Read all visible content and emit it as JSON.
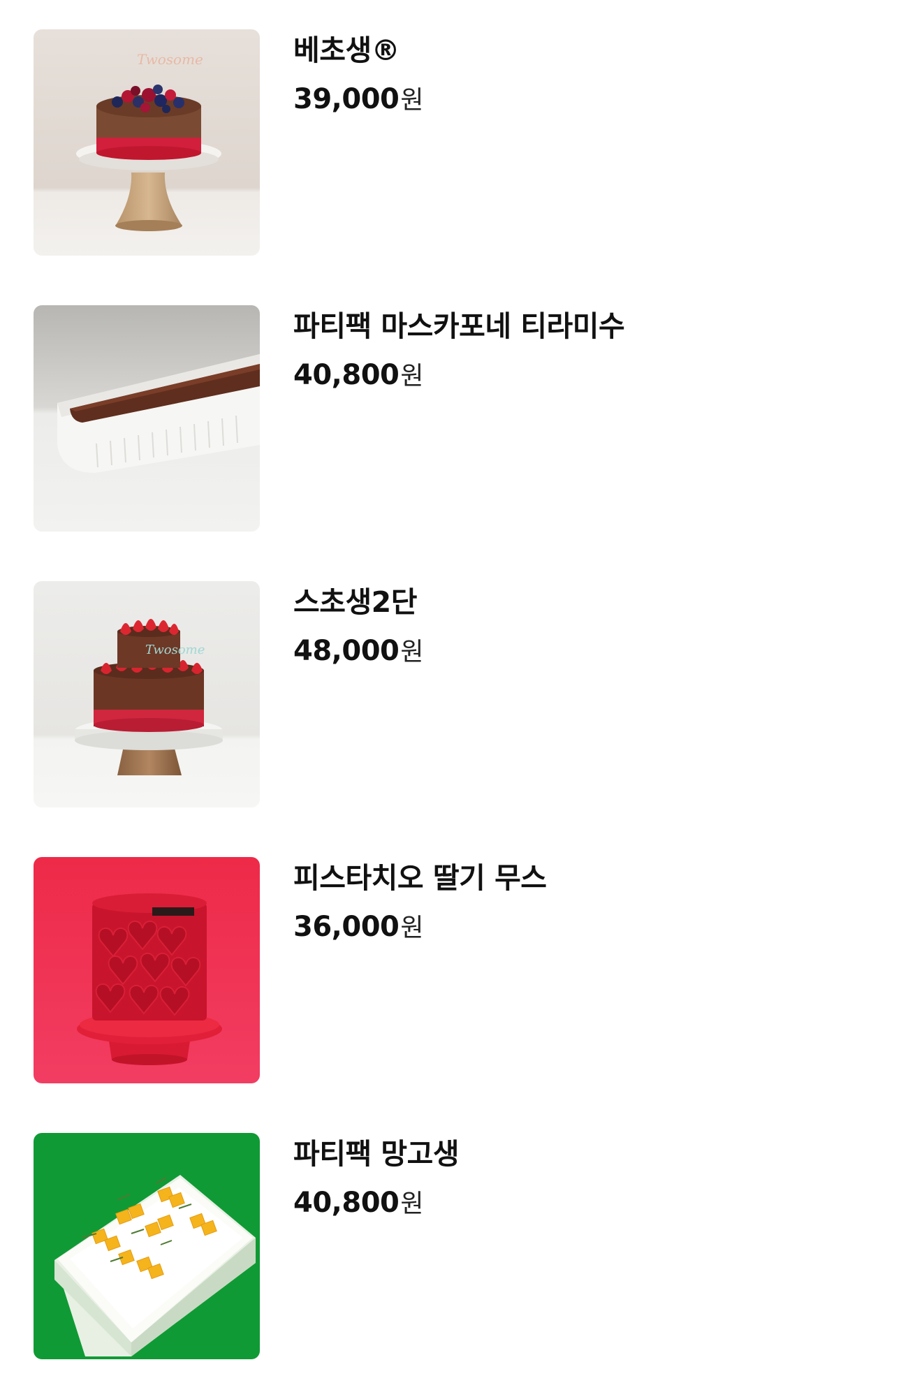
{
  "products": [
    {
      "name": "베초생®",
      "price": "39,000",
      "currency": "원",
      "image": "chocolate-berry-cake-photo"
    },
    {
      "name": "파티팩 마스카포네 티라미수",
      "price": "40,800",
      "currency": "원",
      "image": "tiramisu-tray-photo"
    },
    {
      "name": "스초생2단",
      "price": "48,000",
      "currency": "원",
      "image": "two-tier-strawberry-cake-photo"
    },
    {
      "name": "피스타치오 딸기 무스",
      "price": "36,000",
      "currency": "원",
      "image": "red-heart-mousse-cake-photo"
    },
    {
      "name": "파티팩 망고생",
      "price": "40,800",
      "currency": "원",
      "image": "mango-cream-tray-photo"
    }
  ]
}
